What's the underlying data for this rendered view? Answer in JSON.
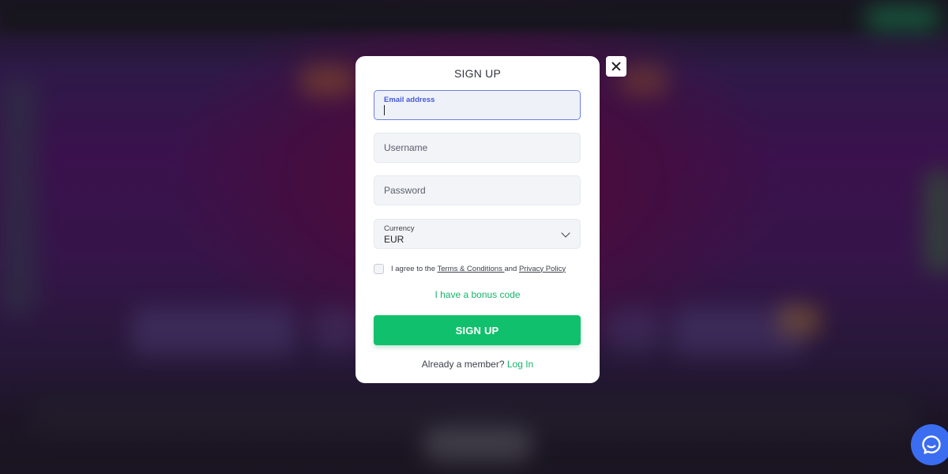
{
  "modal": {
    "title": "SIGN UP",
    "email": {
      "label": "Email address",
      "value": ""
    },
    "username": {
      "placeholder": "Username"
    },
    "password": {
      "placeholder": "Password"
    },
    "currency": {
      "label": "Currency",
      "value": "EUR"
    },
    "agree": {
      "prefix": "I agree to the ",
      "terms_link": "Terms & Conditions ",
      "conjunction": "and ",
      "privacy_link": "Privacy Policy",
      "checked": false
    },
    "bonus_link": "I have a bonus code",
    "submit_label": "SIGN UP",
    "member_text": "Already a member?",
    "login_link": "Log In"
  },
  "icons": {
    "close": "close-icon",
    "chevron": "chevron-down-icon",
    "chat": "chat-icon"
  },
  "colors": {
    "accent_green": "#11c06c",
    "link_green": "#16b36b",
    "focus_blue": "#4658d6",
    "chat_blue": "#3b6df0"
  }
}
